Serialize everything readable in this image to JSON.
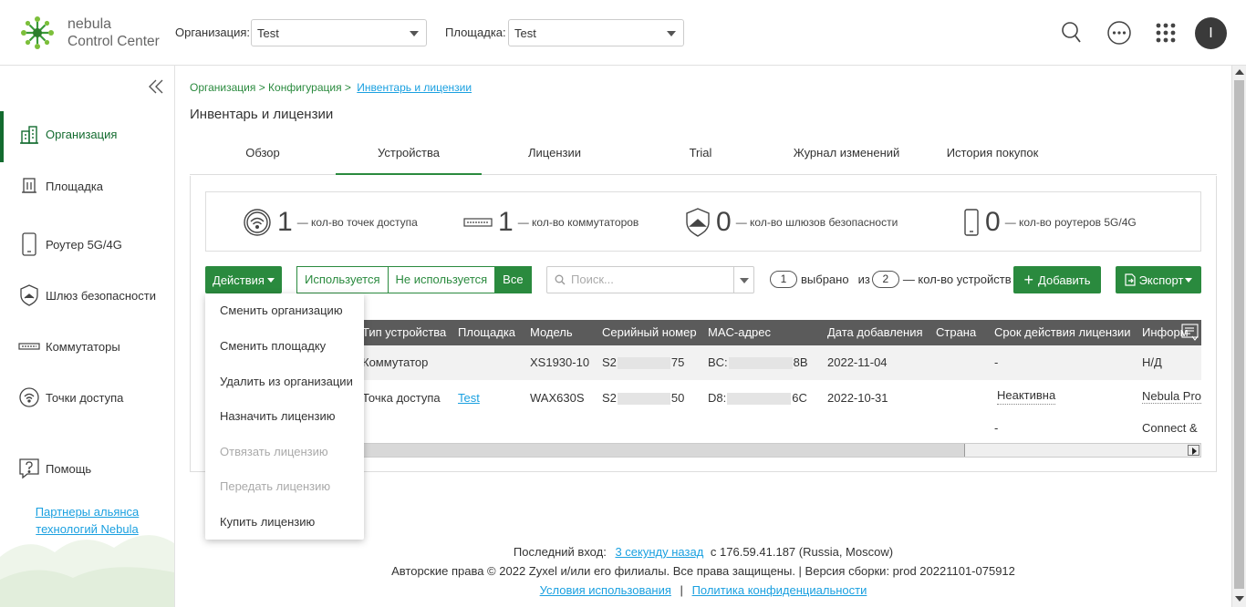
{
  "header": {
    "brand_line1": "nebula",
    "brand_line2": "Control Center",
    "org_label": "Организация:",
    "org_value": "Test",
    "site_label": "Площадка:",
    "site_value": "Test",
    "avatar_letter": "I"
  },
  "sidebar": {
    "items": [
      {
        "label": "Организация",
        "icon": "building-icon"
      },
      {
        "label": "Площадка",
        "icon": "site-icon"
      },
      {
        "label": "Роутер 5G/4G",
        "icon": "phone-router-icon"
      },
      {
        "label": "Шлюз безопасности",
        "icon": "shield-icon"
      },
      {
        "label": "Коммутаторы",
        "icon": "switch-icon"
      },
      {
        "label": "Точки доступа",
        "icon": "wifi-icon"
      },
      {
        "label": "Помощь",
        "icon": "help-icon"
      }
    ],
    "partners_line1": "Партнеры альянса",
    "partners_line2": "технологий Nebula"
  },
  "breadcrumb": {
    "part1": "Организация > Конфигурация >",
    "current": "Инвентарь и лицензии"
  },
  "page_title": "Инвентарь и лицензии",
  "tabs": [
    "Обзор",
    "Устройства",
    "Лицензии",
    "Trial",
    "Журнал изменений",
    "История покупок"
  ],
  "stats": [
    {
      "value": "1",
      "label": "— кол-во точек доступа"
    },
    {
      "value": "1",
      "label": "— кол-во коммутаторов"
    },
    {
      "value": "0",
      "label": "— кол-во шлюзов безопасности"
    },
    {
      "value": "0",
      "label": "— кол-во роутеров 5G/4G"
    }
  ],
  "toolbar": {
    "actions_label": "Действия",
    "filter_used": "Используется",
    "filter_unused": "Не используется",
    "filter_all": "Все",
    "search_placeholder": "Поиск...",
    "selected_count": "1",
    "selected_text": "выбрано",
    "of_text": "из",
    "total_count": "2",
    "total_text": "— кол-во устройств",
    "add_label": "Добавить",
    "export_label": "Экспорт"
  },
  "actions_menu": [
    {
      "label": "Сменить организацию",
      "enabled": true
    },
    {
      "label": "Сменить площадку",
      "enabled": true
    },
    {
      "label": "Удалить из организации",
      "enabled": true
    },
    {
      "label": "Назначить лицензию",
      "enabled": true
    },
    {
      "label": "Отвязать лицензию",
      "enabled": false
    },
    {
      "label": "Передать лицензию",
      "enabled": false
    },
    {
      "label": "Купить лицензию",
      "enabled": true
    }
  ],
  "table": {
    "columns": [
      "Тип устройства",
      "Площадка",
      "Модель",
      "Серийный номер",
      "MAC-адрес",
      "Дата добавления",
      "Страна",
      "Срок действия лицензии",
      "Информ"
    ],
    "rows": [
      {
        "type": "Коммутатор",
        "site": "",
        "model": "XS1930-10",
        "serial_a": "S2",
        "serial_b": "75",
        "mac_a": "BC:",
        "mac_b": "8B",
        "date": "2022-11-04",
        "country": "",
        "license": "-",
        "info": "Н/Д"
      },
      {
        "type": "Точка доступа",
        "site": "Test",
        "model": "WAX630S",
        "serial_a": "S2",
        "serial_b": "50",
        "mac_a": "D8:",
        "mac_b": "6C",
        "date": "2022-10-31",
        "country": "",
        "license": "Неактивна",
        "license2": "-",
        "info": "Nebula Pro",
        "info2": "Connect &"
      }
    ]
  },
  "footer": {
    "last_login_label": "Последний вход:",
    "last_login_link": "3 секунду назад",
    "last_login_ip": "с 176.59.41.187 (Russia, Moscow)",
    "copyright": "Авторские права © 2022 Zyxel и/или его филиалы. Все права защищены. | Версия сборки: prod 20221101-075912",
    "terms": "Условия использования",
    "separator": "|",
    "privacy": "Политика конфиденциальности"
  },
  "colors": {
    "brand_green": "#2a8a3e",
    "nav_active": "#136b2f",
    "link_blue": "#1aa0e0",
    "table_header": "#5b5b5b"
  }
}
